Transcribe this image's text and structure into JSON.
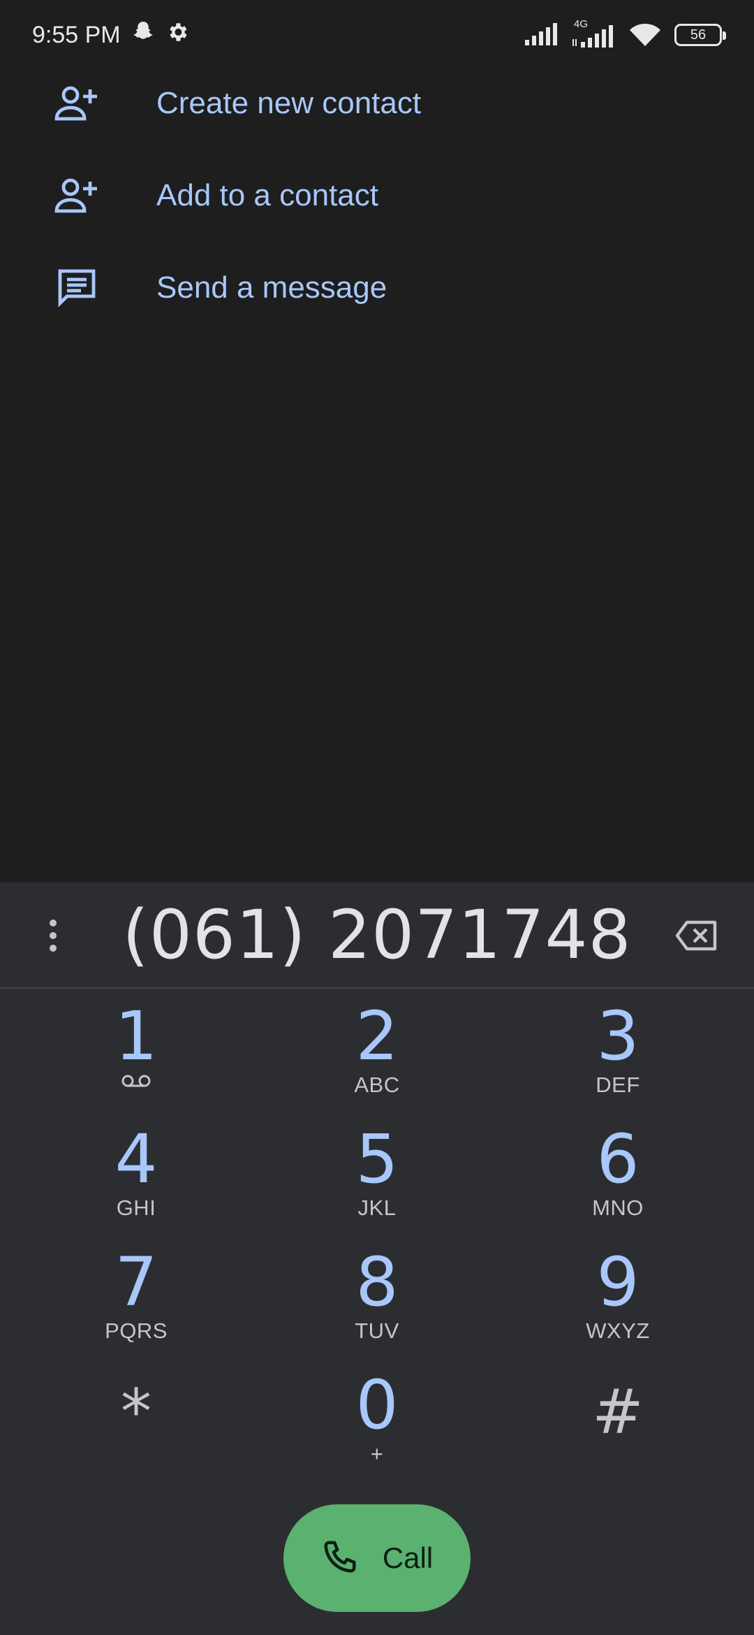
{
  "status_bar": {
    "time": "9:55 PM",
    "network_label": "4G",
    "battery_level": "56",
    "icons": [
      "snapchat-icon",
      "settings-gear-icon",
      "signal-icon",
      "signal-4g-icon",
      "wifi-icon"
    ]
  },
  "actions": [
    {
      "label": "Create new contact",
      "icon": "person-add-icon"
    },
    {
      "label": "Add to a contact",
      "icon": "person-add-icon"
    },
    {
      "label": "Send a message",
      "icon": "message-icon"
    }
  ],
  "dialpad": {
    "number": "(061) 2071748",
    "keys": [
      {
        "digit": "1",
        "letters": ""
      },
      {
        "digit": "2",
        "letters": "ABC"
      },
      {
        "digit": "3",
        "letters": "DEF"
      },
      {
        "digit": "4",
        "letters": "GHI"
      },
      {
        "digit": "5",
        "letters": "JKL"
      },
      {
        "digit": "6",
        "letters": "MNO"
      },
      {
        "digit": "7",
        "letters": "PQRS"
      },
      {
        "digit": "8",
        "letters": "TUV"
      },
      {
        "digit": "9",
        "letters": "WXYZ"
      },
      {
        "digit": "*",
        "letters": ""
      },
      {
        "digit": "0",
        "letters": "+"
      },
      {
        "digit": "#",
        "letters": ""
      }
    ],
    "call_label": "Call"
  },
  "colors": {
    "background": "#1e1e1f",
    "sheet": "#2c2d31",
    "accent": "#a8c7fa",
    "call_green": "#5bb16f"
  }
}
